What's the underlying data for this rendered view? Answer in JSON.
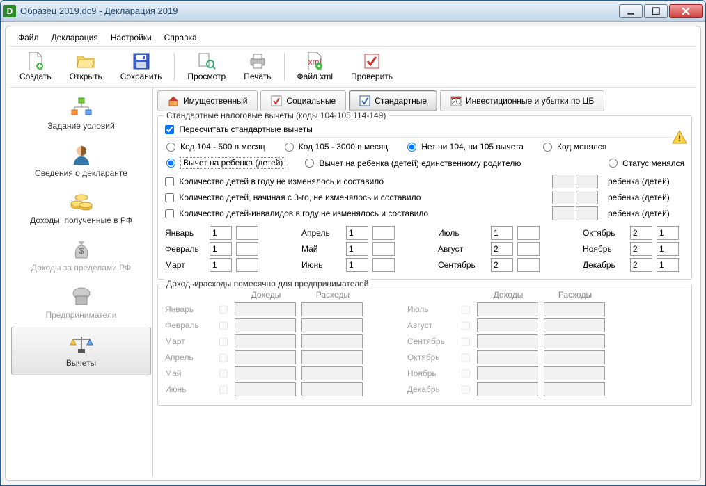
{
  "window": {
    "title": "Образец 2019.dc9 - Декларация 2019"
  },
  "menu": {
    "file": "Файл",
    "decl": "Декларация",
    "settings": "Настройки",
    "help": "Справка"
  },
  "toolbar": {
    "create": "Создать",
    "open": "Открыть",
    "save": "Сохранить",
    "preview": "Просмотр",
    "print": "Печать",
    "xml": "Файл xml",
    "check": "Проверить"
  },
  "sidebar": {
    "items": [
      {
        "label": "Задание условий"
      },
      {
        "label": "Сведения о декларанте"
      },
      {
        "label": "Доходы, полученные в РФ"
      },
      {
        "label": "Доходы за пределами РФ"
      },
      {
        "label": "Предприниматели"
      },
      {
        "label": "Вычеты"
      }
    ]
  },
  "tabs": {
    "property": "Имущественный",
    "social": "Социальные",
    "standard": "Стандартные",
    "invest": "Инвестиционные и убытки по ЦБ"
  },
  "std": {
    "group_title": "Стандартные налоговые вычеты (коды 104-105,114-149)",
    "recalc": "Пересчитать стандартные вычеты",
    "opt104": "Код 104 - 500 в месяц",
    "opt105": "Код 105 - 3000 в месяц",
    "optnone": "Нет ни 104, ни 105 вычета",
    "optchanged": "Код менялся",
    "child_opt1": "Вычет на ребенка (детей)",
    "child_opt2": "Вычет на ребенка (детей) единственному родителю",
    "status_changed": "Статус менялся",
    "cnt1": "Количество детей в году не изменялось и составило",
    "cnt2": "Количество детей, начиная с 3-го, не изменялось и составило",
    "cnt3": "Количество детей-инвалидов в году не изменялось и составило",
    "tail": "ребенка (детей)",
    "months": {
      "jan": {
        "l": "Январь",
        "a": "1",
        "b": ""
      },
      "feb": {
        "l": "Февраль",
        "a": "1",
        "b": ""
      },
      "mar": {
        "l": "Март",
        "a": "1",
        "b": ""
      },
      "apr": {
        "l": "Апрель",
        "a": "1",
        "b": ""
      },
      "may": {
        "l": "Май",
        "a": "1",
        "b": ""
      },
      "jun": {
        "l": "Июнь",
        "a": "1",
        "b": ""
      },
      "jul": {
        "l": "Июль",
        "a": "1",
        "b": ""
      },
      "aug": {
        "l": "Август",
        "a": "2",
        "b": ""
      },
      "sep": {
        "l": "Сентябрь",
        "a": "2",
        "b": ""
      },
      "oct": {
        "l": "Октябрь",
        "a": "2",
        "b": "1"
      },
      "nov": {
        "l": "Ноябрь",
        "a": "2",
        "b": "1"
      },
      "dec": {
        "l": "Декабрь",
        "a": "2",
        "b": "1"
      }
    }
  },
  "ent": {
    "title": "Доходы/расходы помесячно для предпринимателей",
    "income": "Доходы",
    "expense": "Расходы",
    "months_l": [
      "Январь",
      "Февраль",
      "Март",
      "Апрель",
      "Май",
      "Июнь"
    ],
    "months_r": [
      "Июль",
      "Август",
      "Сентябрь",
      "Октябрь",
      "Ноябрь",
      "Декабрь"
    ]
  }
}
